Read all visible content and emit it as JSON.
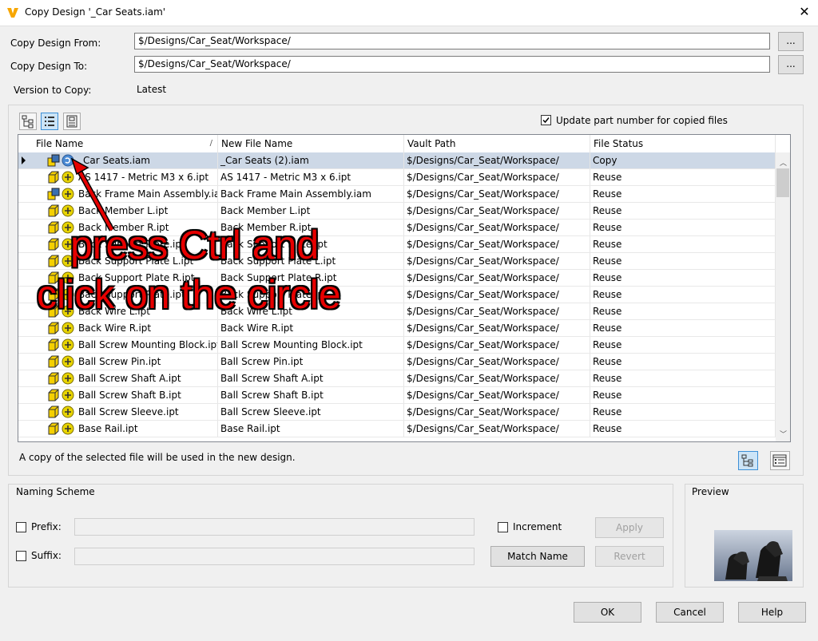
{
  "window": {
    "title": "Copy Design '_Car Seats.iam'",
    "close_glyph": "✕"
  },
  "copy_from": {
    "label": "Copy Design From:",
    "value": "$/Designs/Car_Seat/Workspace/",
    "browse": "..."
  },
  "copy_to": {
    "label": "Copy Design To:",
    "value": "$/Designs/Car_Seat/Workspace/",
    "browse": "..."
  },
  "version": {
    "label": "Version to Copy:",
    "value": "Latest"
  },
  "update_part_number": {
    "label": "Update part number for copied files",
    "checked": true
  },
  "grid": {
    "columns": [
      "File Name",
      "New File Name",
      "Vault Path",
      "File Status"
    ],
    "sort_glyph": "/",
    "rows": [
      {
        "file": "_Car Seats.iam",
        "new": "_Car Seats (2).iam",
        "path": "$/Designs/Car_Seat/Workspace/",
        "status": "Copy",
        "icon": "assembly-icon",
        "action": "copy-action-icon"
      },
      {
        "file": "AS 1417 - Metric M3 x 6.ipt",
        "new": "AS 1417 - Metric M3 x 6.ipt",
        "path": "$/Designs/Car_Seat/Workspace/",
        "status": "Reuse",
        "icon": "part-icon",
        "action": "reuse-action-icon"
      },
      {
        "file": "Back Frame Main Assembly.iam",
        "new": "Back Frame Main Assembly.iam",
        "path": "$/Designs/Car_Seat/Workspace/",
        "status": "Reuse",
        "icon": "assembly-icon",
        "action": "reuse-action-icon"
      },
      {
        "file": "Back Member L.ipt",
        "new": "Back Member L.ipt",
        "path": "$/Designs/Car_Seat/Workspace/",
        "status": "Reuse",
        "icon": "part-icon",
        "action": "reuse-action-icon"
      },
      {
        "file": "Back Member R.ipt",
        "new": "Back Member R.ipt",
        "path": "$/Designs/Car_Seat/Workspace/",
        "status": "Reuse",
        "icon": "part-icon",
        "action": "reuse-action-icon"
      },
      {
        "file": "Back Support Plate.ipt",
        "new": "Back Support Plate.ipt",
        "path": "$/Designs/Car_Seat/Workspace/",
        "status": "Reuse",
        "icon": "part-icon",
        "action": "reuse-action-icon"
      },
      {
        "file": "Back Support Plate L.ipt",
        "new": "Back Support Plate L.ipt",
        "path": "$/Designs/Car_Seat/Workspace/",
        "status": "Reuse",
        "icon": "part-icon",
        "action": "reuse-action-icon"
      },
      {
        "file": "Back Support Plate R.ipt",
        "new": "Back Support Plate R.ipt",
        "path": "$/Designs/Car_Seat/Workspace/",
        "status": "Reuse",
        "icon": "part-icon",
        "action": "reuse-action-icon"
      },
      {
        "file": "Back Support Plate.ipt",
        "new": "Back Support Plate.ipt",
        "path": "$/Designs/Car_Seat/Workspace/",
        "status": "Reuse",
        "icon": "part-icon",
        "action": "reuse-action-icon"
      },
      {
        "file": "Back Wire L.ipt",
        "new": "Back Wire L.ipt",
        "path": "$/Designs/Car_Seat/Workspace/",
        "status": "Reuse",
        "icon": "part-icon",
        "action": "reuse-action-icon"
      },
      {
        "file": "Back Wire R.ipt",
        "new": "Back Wire R.ipt",
        "path": "$/Designs/Car_Seat/Workspace/",
        "status": "Reuse",
        "icon": "part-icon",
        "action": "reuse-action-icon"
      },
      {
        "file": "Ball Screw Mounting Block.ipt",
        "new": "Ball Screw Mounting Block.ipt",
        "path": "$/Designs/Car_Seat/Workspace/",
        "status": "Reuse",
        "icon": "part-icon",
        "action": "reuse-action-icon"
      },
      {
        "file": "Ball Screw Pin.ipt",
        "new": "Ball Screw Pin.ipt",
        "path": "$/Designs/Car_Seat/Workspace/",
        "status": "Reuse",
        "icon": "part-icon",
        "action": "reuse-action-icon"
      },
      {
        "file": "Ball Screw Shaft A.ipt",
        "new": "Ball Screw Shaft A.ipt",
        "path": "$/Designs/Car_Seat/Workspace/",
        "status": "Reuse",
        "icon": "part-icon",
        "action": "reuse-action-icon"
      },
      {
        "file": "Ball Screw Shaft B.ipt",
        "new": "Ball Screw Shaft B.ipt",
        "path": "$/Designs/Car_Seat/Workspace/",
        "status": "Reuse",
        "icon": "part-icon",
        "action": "reuse-action-icon"
      },
      {
        "file": "Ball Screw Sleeve.ipt",
        "new": "Ball Screw Sleeve.ipt",
        "path": "$/Designs/Car_Seat/Workspace/",
        "status": "Reuse",
        "icon": "part-icon",
        "action": "reuse-action-icon"
      },
      {
        "file": "Base Rail.ipt",
        "new": "Base Rail.ipt",
        "path": "$/Designs/Car_Seat/Workspace/",
        "status": "Reuse",
        "icon": "part-icon",
        "action": "reuse-action-icon"
      }
    ]
  },
  "status_text": "A copy of the selected file will be used in the new design.",
  "naming": {
    "title": "Naming Scheme",
    "prefix_label": "Prefix:",
    "suffix_label": "Suffix:",
    "increment_label": "Increment",
    "apply": "Apply",
    "revert": "Revert",
    "match_name": "Match Name"
  },
  "preview": {
    "title": "Preview"
  },
  "buttons": {
    "ok": "OK",
    "cancel": "Cancel",
    "help": "Help"
  },
  "annotation": {
    "line1": "press Ctrl and",
    "line2": "click on the circle"
  },
  "colors": {
    "app_icon": "#f7a600",
    "selected_row": "#cdd8e6",
    "annotation": "#e60000",
    "part_icon": "#f5d000",
    "reuse_circle": "#e8d400"
  }
}
